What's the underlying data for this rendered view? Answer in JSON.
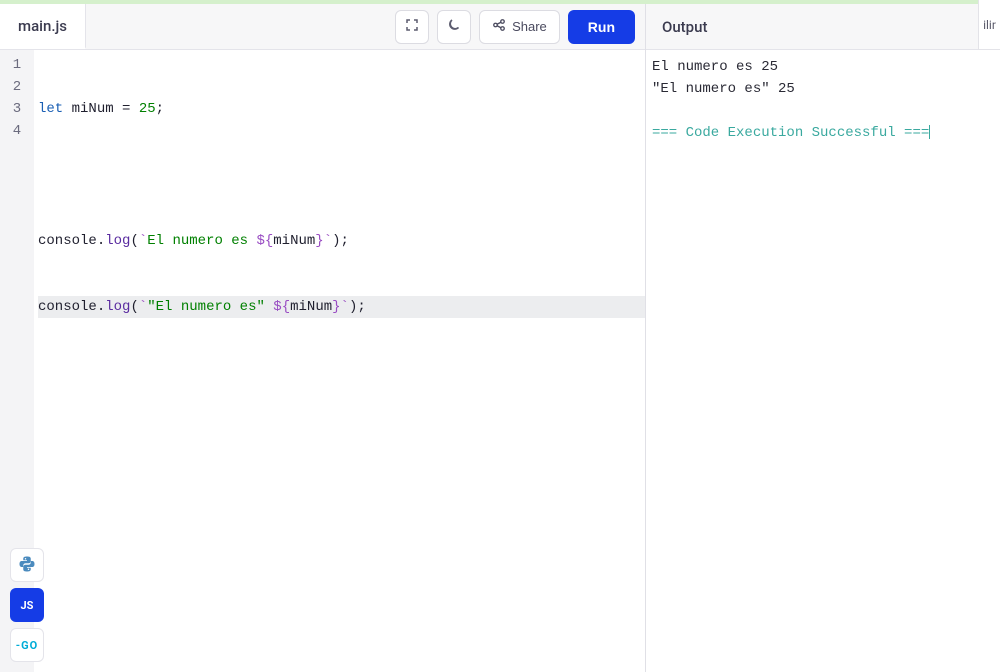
{
  "header": {
    "filename": "main.js",
    "share_label": "Share",
    "run_label": "Run"
  },
  "code": {
    "lines": [
      {
        "n": "1"
      },
      {
        "n": "2"
      },
      {
        "n": "3"
      },
      {
        "n": "4"
      }
    ],
    "tokens": {
      "let": "let",
      "var1": "miNum",
      "eq": "=",
      "num": "25",
      "semi": ";",
      "console": "console",
      "dot": ".",
      "log": "log",
      "lparen": "(",
      "rparen": ")",
      "backtick": "`",
      "tmpl_text1": "El numero es ",
      "tmpl_text2_open": "\"",
      "tmpl_text2_mid": "El numero es",
      "tmpl_text2_close": "\"",
      "tmpl_space": " ",
      "interp_open": "${",
      "interp_close": "}",
      "interp_var": "miNum"
    }
  },
  "output": {
    "title": "Output",
    "lines": [
      "El numero es 25",
      "\"El numero es\" 25"
    ],
    "success": "=== Code Execution Successful ==="
  },
  "sidebar": {
    "js_label": "JS",
    "go_label": "-GO"
  },
  "right_edge": "ilir"
}
